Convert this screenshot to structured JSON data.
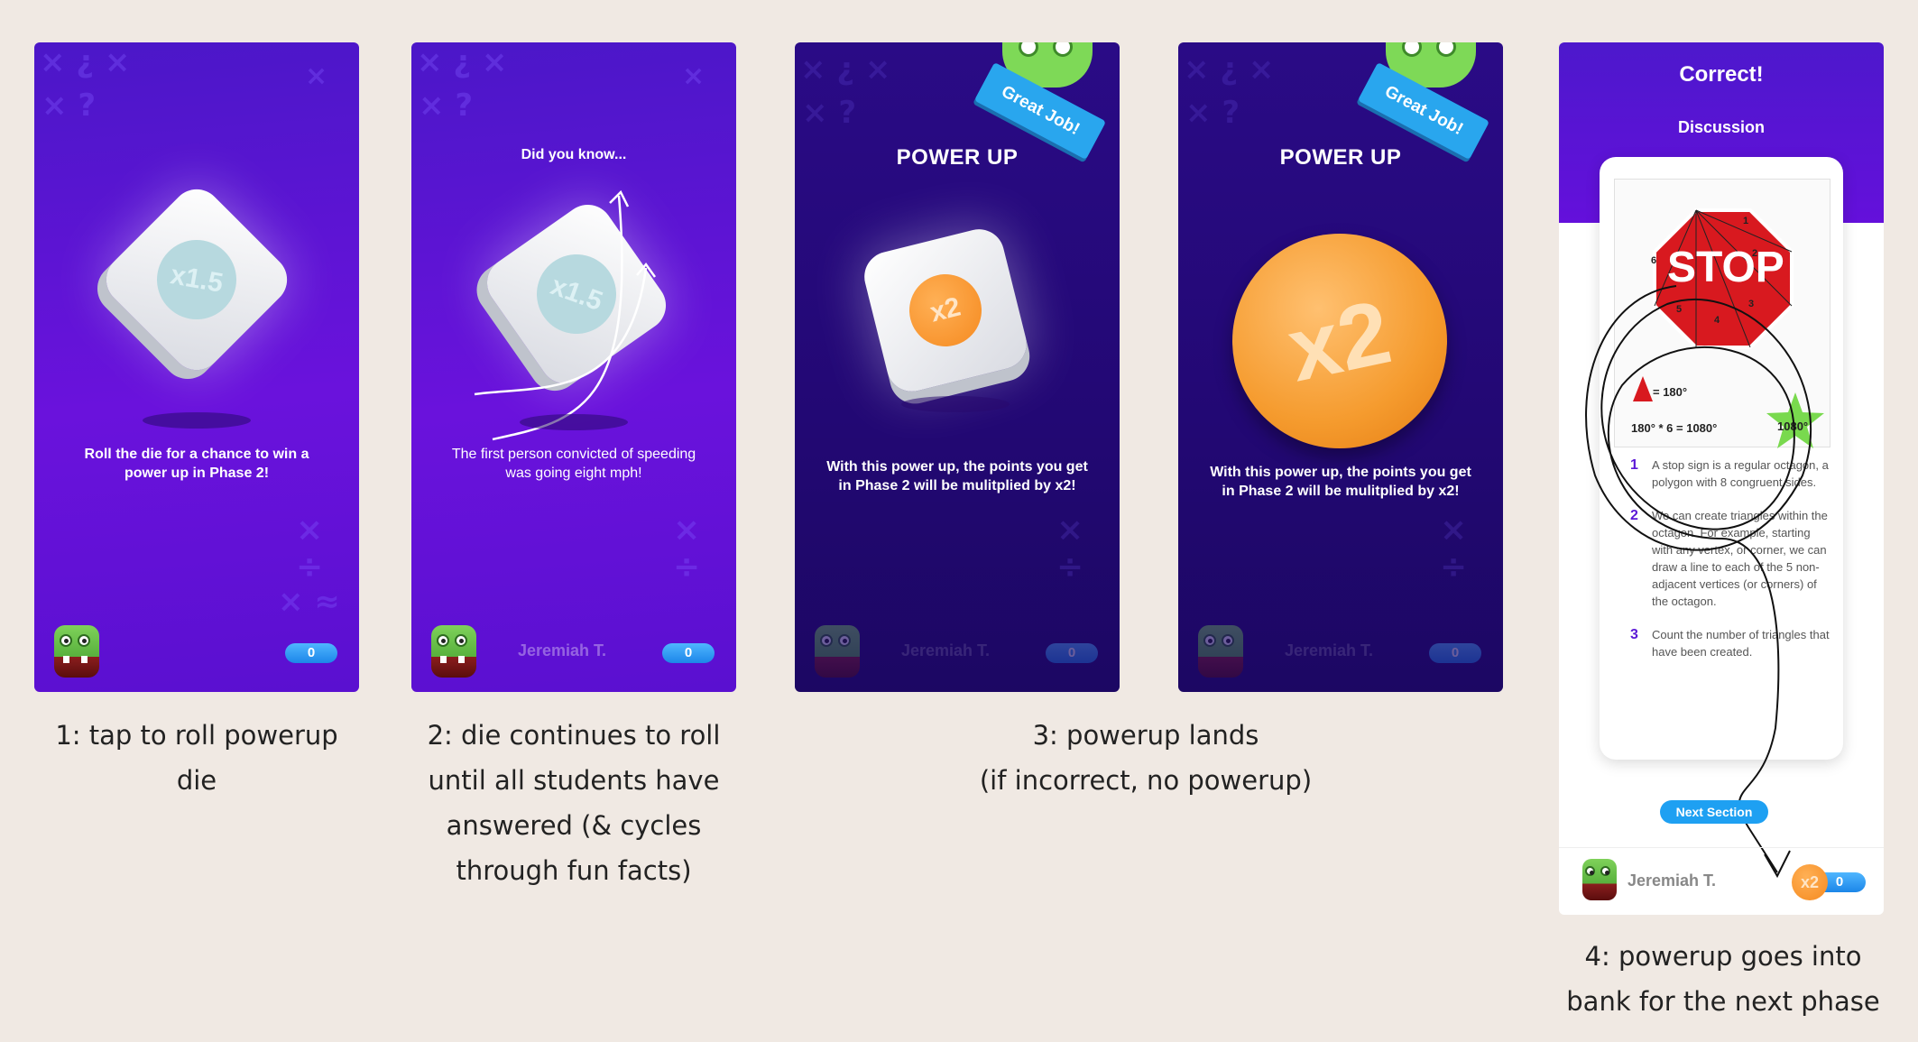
{
  "screens": [
    {
      "message": "Roll the die for a chance to win a power up in Phase 2!",
      "die_label": "x1.5",
      "score": "0"
    },
    {
      "top_text": "Did you know...",
      "message": "The first person convicted of speeding was going eight mph!",
      "die_label": "x1.5",
      "player": "Jeremiah T.",
      "score": "0"
    },
    {
      "badge": "Great Job!",
      "title": "POWER UP",
      "die_label": "x2",
      "message": "With this power up, the points you get in Phase 2 will be mulitplied by x2!",
      "player": "Jeremiah T.",
      "score": "0"
    },
    {
      "badge": "Great Job!",
      "title": "POWER UP",
      "coin_label": "x2",
      "message": "With this power up, the points you get in Phase 2 will be mulitplied by x2!",
      "player": "Jeremiah T.",
      "score": "0"
    },
    {
      "title": "Correct!",
      "subtitle": "Discussion",
      "diagram": {
        "sign_text": "STOP",
        "triangle_eq": "= 180°",
        "total_eq": "180° * 6 = 1080°",
        "star_value": "1080°",
        "numbers": [
          "1",
          "2",
          "3",
          "4",
          "5",
          "6"
        ]
      },
      "steps": [
        {
          "num": "1",
          "text": "A stop sign is a regular octagon, a polygon with 8 congruent sides."
        },
        {
          "num": "2",
          "text": "We can create triangles within the octagon. For example, starting with any vertex, or corner, we can draw a line to each of the 5 non-adjacent vertices (or corners) of the octagon."
        },
        {
          "num": "3",
          "text": "Count the number of triangles that have been created."
        }
      ],
      "next_button": "Next Section",
      "player": "Jeremiah T.",
      "powerup": "x2",
      "score": "0"
    }
  ],
  "captions": {
    "c1": "1: tap to roll powerup die",
    "c2_lines": [
      "2: die continues to roll",
      "until all students have",
      "answered (& cycles",
      "through fun facts)"
    ],
    "c3_lines": [
      "3: powerup lands",
      "(if incorrect, no powerup)"
    ],
    "c4_lines": [
      "4: powerup goes into",
      "bank for the next phase"
    ]
  },
  "colors": {
    "background": "#f0e9e3",
    "purple": "#5b12d6",
    "orange": "#f58a20",
    "blue": "#1ea0f2"
  }
}
